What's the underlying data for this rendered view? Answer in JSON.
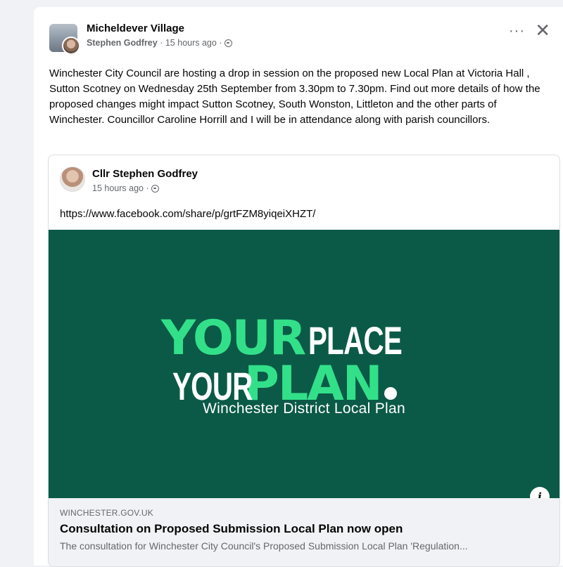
{
  "post": {
    "group_name": "Micheldever Village",
    "author": "Stephen Godfrey",
    "time": "15 hours ago",
    "separator": "·",
    "more_label": "···",
    "close_label": "✕",
    "text": "Winchester City Council are hosting a drop in session on the proposed new Local Plan at Victoria Hall , Sutton Scotney on Wednesday 25th September from 3.30pm to 7.30pm.  Find out more details of how the proposed changes might impact Sutton Scotney, South Wonston, Littleton and the other parts of Winchester.  Councillor Caroline Horrill and I will be in attendance along with parish councillors."
  },
  "shared": {
    "name": "Cllr Stephen Godfrey",
    "time": "15 hours ago",
    "link": "https://www.facebook.com/share/p/grtFZM8yiqeiXHZT/",
    "banner": {
      "your1": "YOUR",
      "place": "PLACE",
      "your2": "YOUR",
      "plan": "PLAN",
      "subtitle": "Winchester District Local Plan"
    },
    "info_label": "i",
    "preview": {
      "domain": "WINCHESTER.GOV.UK",
      "title": "Consultation on Proposed Submission Local Plan now open",
      "description": "The consultation for Winchester City Council's Proposed Submission Local Plan 'Regulation..."
    }
  },
  "colors": {
    "banner_bg": "#0b5a47",
    "banner_green": "#33e08a",
    "meta_text": "#65676b"
  }
}
